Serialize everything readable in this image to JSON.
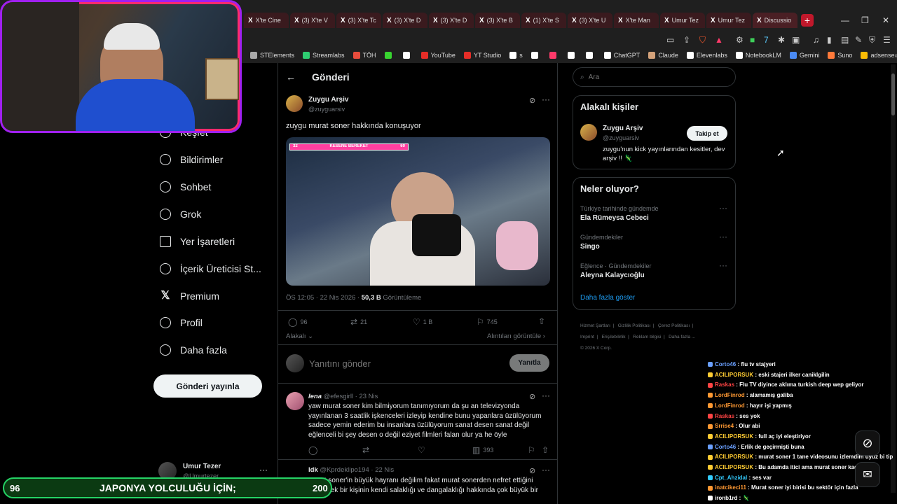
{
  "browser": {
    "tabs": [
      "X'te Cine",
      "(3) X'te V",
      "(3) X'te Tc",
      "(3) X'te D",
      "(3) X'te D",
      "(3) X'te B",
      "(1) X'te S",
      "(3) X'te U",
      "X'te Man",
      "Umur Tez",
      "Umur Tez",
      "Discussio"
    ],
    "bookmarks": [
      "STElements",
      "Streamlabs",
      "TÖH",
      "",
      "",
      "YouTube",
      "YT Studio",
      "s",
      "",
      "",
      "",
      "",
      "ChatGPT",
      "Claude",
      "Elevenlabs",
      "NotebookLM",
      "Gemini",
      "Suno",
      "adsense"
    ],
    "new_tab": "+"
  },
  "sidebar": {
    "items": [
      {
        "label": "Keşfet",
        "icon": "search-icon"
      },
      {
        "label": "Bildirimler",
        "icon": "bell-icon"
      },
      {
        "label": "Sohbet",
        "icon": "chat-icon"
      },
      {
        "label": "Grok",
        "icon": "grok-icon"
      },
      {
        "label": "Yer İşaretleri",
        "icon": "bookmark-icon"
      },
      {
        "label": "İçerik Üreticisi St...",
        "icon": "rocket-icon"
      },
      {
        "label": "Premium",
        "icon": "x-logo-icon"
      },
      {
        "label": "Profil",
        "icon": "person-icon"
      },
      {
        "label": "Daha fazla",
        "icon": "more-circle-icon"
      }
    ],
    "post_button": "Gönderi yayınla",
    "account": {
      "name": "Umur Tezer",
      "handle": "@Umurtezer"
    }
  },
  "main": {
    "header": "Gönderi",
    "post": {
      "author": "Zuygu Arşiv",
      "handle": "@zuyguarsiv",
      "text": "zuygu murat soner hakkında konuşuyor",
      "time": "ÖS 12:05 · 22 Nis 2026 · ",
      "views_count": "50,3 B",
      "views_label": " Görüntüleme",
      "replies": "96",
      "reposts": "21",
      "likes": "1 B",
      "bookmarks": "745",
      "relevance": "Alakalı",
      "quotes": "Alıntıları görüntüle",
      "video_overlay_label": "KESENE BEREKET",
      "video_overlay_left": "32",
      "video_overlay_right": "60"
    },
    "reply_box": {
      "placeholder": "Yanıtını gönder",
      "button": "Yanıtla"
    },
    "replies": [
      {
        "name": "lena",
        "handle": "@efesgirll · 23 Nis",
        "text": "yaw murat soner kim bilmiyorum tanımıyorum da şu an televizyonda yayınlanan 3 saatlik işkenceleri izleyip kendine bunu yapanlara üzülüyorum sadece yemin ederim bu insanlara üzülüyorum sanat desen sanat değil eğlenceli bi şey desen o değil eziyet filmleri falan olur ya he öyle",
        "views": "393"
      },
      {
        "name": "ldk",
        "handle": "@Kprdeklipo194 · 22 Nis",
        "text": "murat soner'in büyük hayranı değilim fakat murat sonerden nefret ettiğini söylemek bir kişinin kendi salaklığı ve dangalaklığı hakkında çok büyük bir"
      }
    ]
  },
  "right": {
    "search_placeholder": "Ara",
    "relevant": {
      "title": "Alakalı kişiler",
      "name": "Zuygu Arşiv",
      "handle": "@zuyguarsiv",
      "bio": "zuygu'nun kick yayınlarından kesitler, dev arşiv !! 🦎",
      "follow": "Takip et"
    },
    "trends": {
      "title": "Neler oluyor?",
      "items": [
        {
          "sub": "Türkiye tarihinde gündemde",
          "title": "Ela Rümeysa Cebeci"
        },
        {
          "sub": "Gündemdekiler",
          "title": "Singo"
        },
        {
          "sub": "Eğlence · Gündemdekiler",
          "title": "Aleyna Kalaycıoğlu"
        }
      ],
      "more": "Daha fazla göster"
    },
    "footer": [
      "Hizmet Şartları",
      "Gizlilik Politikası",
      "Çerez Politikası",
      "Imprint",
      "Erişilebilirlik",
      "Reklam bilgisi",
      "Daha fazla ...",
      "© 2026 X Corp."
    ]
  },
  "chat": [
    {
      "user": "Corto46",
      "msg": " : flu tv stajyeri",
      "color": "#6aa0ff"
    },
    {
      "user": "ACILIPORSUK",
      "msg": " : eski stajeri ilker caniklgilin",
      "color": "#ffcc33"
    },
    {
      "user": "Raskas",
      "msg": " : Flu TV diyince aklıma turkish deep wep geliyor",
      "color": "#ff4444"
    },
    {
      "user": "LordFinrod",
      "msg": " : alamamış galiba",
      "color": "#ff9933"
    },
    {
      "user": "LordFinrod",
      "msg": " : hayır işi yapmış",
      "color": "#ff9933"
    },
    {
      "user": "Raskas",
      "msg": " : ses yok",
      "color": "#ff4444"
    },
    {
      "user": "Srrise4",
      "msg": " : Olur abi",
      "color": "#ff9933"
    },
    {
      "user": "ACILIPORSUK",
      "msg": " : full aç iyi eleştiriyor",
      "color": "#ffcc33"
    },
    {
      "user": "Corto46",
      "msg": " : Erlik de geçirmişti buna",
      "color": "#6aa0ff"
    },
    {
      "user": "ACILIPORSUK",
      "msg": " : murat soner 1 tane videosunu izlemdim uyuz bi tip",
      "color": "#ffcc33"
    },
    {
      "user": "ACILIPORSUK",
      "msg": " : Bu adamda itici ama murat soner kadar değil",
      "color": "#ffcc33"
    },
    {
      "user": "Cpt_Ahzidal",
      "msg": " : ses var",
      "color": "#33ccff"
    },
    {
      "user": "inatcikeci11",
      "msg": " : Murat soner iyi birisi bu sektör için fazla",
      "color": "#ff9933"
    },
    {
      "user": "ironb1rd",
      "msg": " : 🦎",
      "color": "#ffffff"
    }
  ],
  "banner": {
    "left": "96",
    "text": "JAPONYA YOLCULUĞU İÇİN;",
    "right": "200"
  }
}
